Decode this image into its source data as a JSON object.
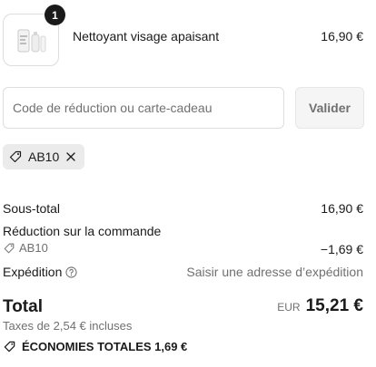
{
  "product": {
    "quantity": "1",
    "name": "Nettoyant visage apaisant",
    "price": "16,90 €",
    "thumbnail_icon": "product-bottle-icon"
  },
  "discount": {
    "placeholder": "Code de réduction ou carte-cadeau",
    "value": "",
    "apply_label": "Valider",
    "applied_code": "AB10",
    "tag_icon": "tag-icon",
    "remove_icon": "close-icon"
  },
  "summary": {
    "subtotal_label": "Sous-total",
    "subtotal_value": "16,90 €",
    "order_discount_label": "Réduction sur la commande",
    "order_discount_code": "AB10",
    "order_discount_value": "−1,69 €",
    "shipping_label": "Expédition",
    "shipping_help_icon": "help-circle-icon",
    "shipping_value": "Saisir une adresse d’expédition"
  },
  "total": {
    "label": "Total",
    "currency": "EUR",
    "amount": "15,21 €",
    "taxes": "Taxes de 2,54 € incluses",
    "savings": "ÉCONOMIES TOTALES 1,69 €"
  },
  "colors": {
    "text": "#1a1a1a",
    "muted": "#707070",
    "border": "#dedede",
    "badge": "#1a1a1a",
    "tag_background": "#ebebeb"
  }
}
